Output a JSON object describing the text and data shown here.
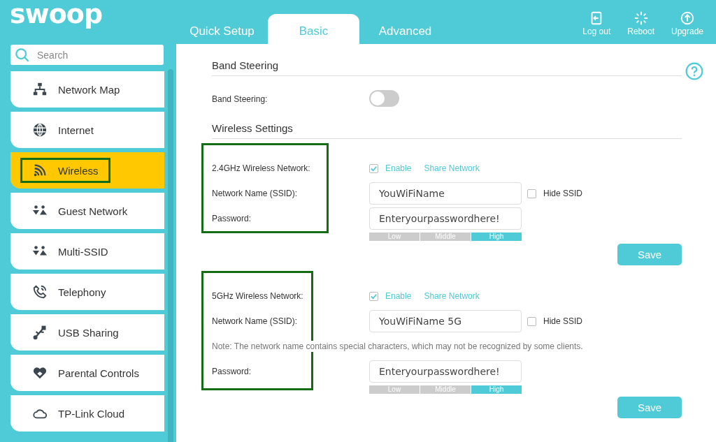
{
  "logo": "swoop",
  "tabs": [
    {
      "label": "Quick Setup",
      "selected": false
    },
    {
      "label": "Basic",
      "selected": true
    },
    {
      "label": "Advanced",
      "selected": false
    }
  ],
  "header_actions": [
    {
      "kind": "logout",
      "label": "Log out"
    },
    {
      "kind": "reboot",
      "label": "Reboot"
    },
    {
      "kind": "upgrade",
      "label": "Upgrade"
    }
  ],
  "search": {
    "placeholder": "Search"
  },
  "sidebar": {
    "items": [
      {
        "kind": "map",
        "label": "Network Map",
        "selected": false,
        "highlighted": false
      },
      {
        "kind": "globe",
        "label": "Internet",
        "selected": false,
        "highlighted": false
      },
      {
        "kind": "wifi",
        "label": "Wireless",
        "selected": true,
        "highlighted": true
      },
      {
        "kind": "people",
        "label": "Guest Network",
        "selected": false,
        "highlighted": false
      },
      {
        "kind": "people",
        "label": "Multi-SSID",
        "selected": false,
        "highlighted": false
      },
      {
        "kind": "phone",
        "label": "Telephony",
        "selected": false,
        "highlighted": false
      },
      {
        "kind": "usb",
        "label": "USB Sharing",
        "selected": false,
        "highlighted": false
      },
      {
        "kind": "heart",
        "label": "Parental Controls",
        "selected": false,
        "highlighted": false
      },
      {
        "kind": "cloud",
        "label": "TP-Link Cloud",
        "selected": false,
        "highlighted": false
      }
    ]
  },
  "band_steering": {
    "title": "Band Steering",
    "label": "Band Steering:",
    "on": false
  },
  "wireless_settings": {
    "title": "Wireless Settings",
    "networks": [
      {
        "label": "2.4GHz Wireless Network:",
        "enable_label": "Enable",
        "enabled": true,
        "share_link": "Share Network",
        "ssid_label": "Network Name (SSID):",
        "ssid": "YouWiFiName",
        "hide_label": "Hide SSID",
        "hidden": false,
        "password_label": "Password:",
        "password": "Enteryourpasswordhere!",
        "strength": [
          {
            "label": "Low",
            "selected": false
          },
          {
            "label": "Middle",
            "selected": false
          },
          {
            "label": "High",
            "selected": true
          }
        ],
        "save": "Save",
        "highlighted": true
      },
      {
        "label": "5GHz Wireless Network:",
        "enable_label": "Enable",
        "enabled": true,
        "share_link": "Share Network",
        "ssid_label": "Network Name (SSID):",
        "ssid": "YouWiFiName 5G",
        "hide_label": "Hide SSID",
        "hidden": false,
        "note": "Note: The network name contains special characters, which may not be recognized by some clients.",
        "password_label": "Password:",
        "password": "Enteryourpasswordhere!",
        "strength": [
          {
            "label": "Low",
            "selected": false
          },
          {
            "label": "Middle",
            "selected": false
          },
          {
            "label": "High",
            "selected": true
          }
        ],
        "save": "Save",
        "highlighted": true
      }
    ]
  }
}
